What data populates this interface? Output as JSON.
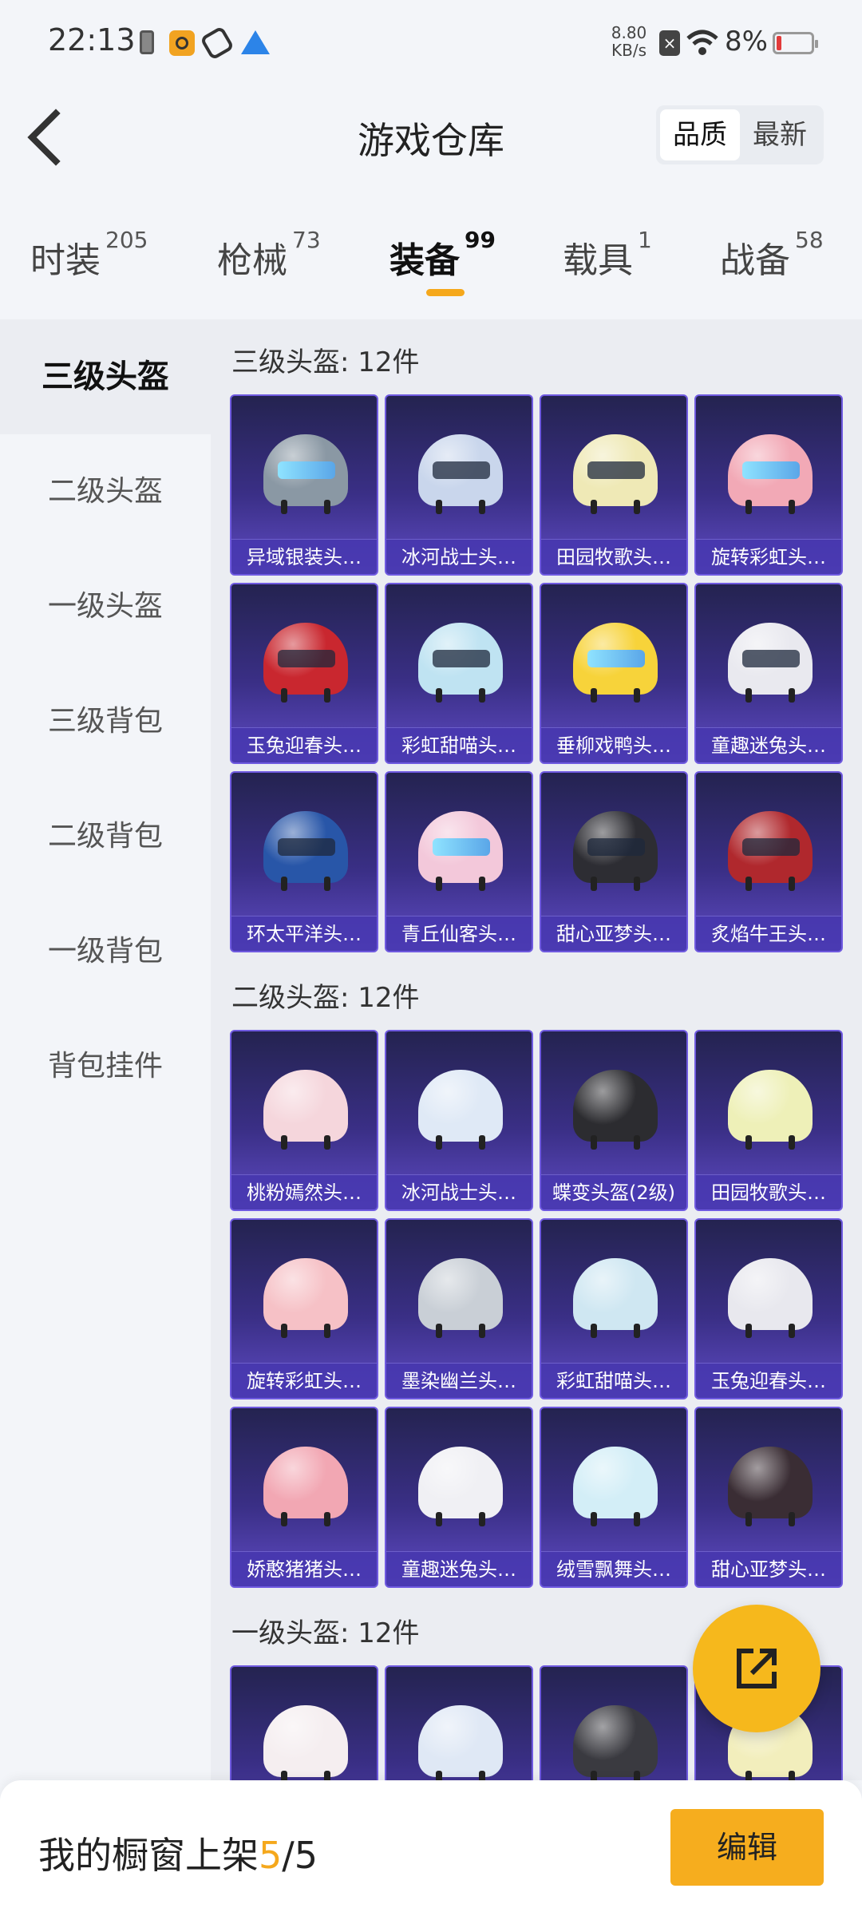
{
  "status_bar": {
    "time": "22:13",
    "net_speed_value": "8.80",
    "net_speed_unit": "KB/s",
    "battery_percent": "8%",
    "icons": [
      "battery-small-icon",
      "app-icon",
      "app-icon",
      "telegram-icon",
      "sim-x-icon",
      "wifi-icon",
      "battery-icon"
    ]
  },
  "header": {
    "title": "游戏仓库",
    "sort_options": [
      "品质",
      "最新"
    ],
    "sort_selected": "品质"
  },
  "category_tabs": [
    {
      "label": "时装",
      "count": "205"
    },
    {
      "label": "枪械",
      "count": "73"
    },
    {
      "label": "装备",
      "count": "99"
    },
    {
      "label": "载具",
      "count": "1"
    },
    {
      "label": "战备",
      "count": "58"
    }
  ],
  "active_tab": "装备",
  "sidebar": {
    "items": [
      "三级头盔",
      "二级头盔",
      "一级头盔",
      "三级背包",
      "二级背包",
      "一级背包",
      "背包挂件"
    ],
    "active": "三级头盔"
  },
  "sections": [
    {
      "title": "三级头盔: 12件",
      "items": [
        "异域银装头…",
        "冰河战士头…",
        "田园牧歌头…",
        "旋转彩虹头…",
        "玉兔迎春头…",
        "彩虹甜喵头…",
        "垂柳戏鸭头…",
        "童趣迷兔头…",
        "环太平洋头…",
        "青丘仙客头…",
        "甜心亚梦头…",
        "炙焰牛王头…"
      ]
    },
    {
      "title": "二级头盔: 12件",
      "items": [
        "桃粉嫣然头…",
        "冰河战士头…",
        "蝶变头盔(2级)",
        "田园牧歌头…",
        "旋转彩虹头…",
        "墨染幽兰头…",
        "彩虹甜喵头…",
        "玉兔迎春头…",
        "娇憨猪猪头…",
        "童趣迷兔头…",
        "绒雪飘舞头…",
        "甜心亚梦头…"
      ]
    },
    {
      "title": "一级头盔: 12件",
      "items": [
        "",
        "",
        "",
        ""
      ]
    }
  ],
  "helmet_colors": {
    "lvl3": [
      "#8a98a4",
      "#c9d6ec",
      "#efe9b6",
      "#f2a9b6",
      "#c9272f",
      "#bfe3f2",
      "#f7d33a",
      "#e9e9ef",
      "#2856a8",
      "#f3c8da",
      "#2d2d33",
      "#b0282d"
    ],
    "lvl2": [
      "#f5d6dc",
      "#dfe9f6",
      "#2c2c30",
      "#eef0b8",
      "#f6c1c6",
      "#c9cfd6",
      "#cfe7f2",
      "#e8e8ee",
      "#f2a7b3",
      "#f0f0f4",
      "#d3eef7",
      "#3a2d34"
    ],
    "lvl1": [
      "#f5eef0",
      "#dfe8f5",
      "#3a3a40",
      "#f2eebc"
    ]
  },
  "showcase": {
    "label": "我的橱窗上架",
    "current": "5",
    "total": "/5"
  },
  "edit_button": "编辑",
  "fab_icon": "share-icon"
}
